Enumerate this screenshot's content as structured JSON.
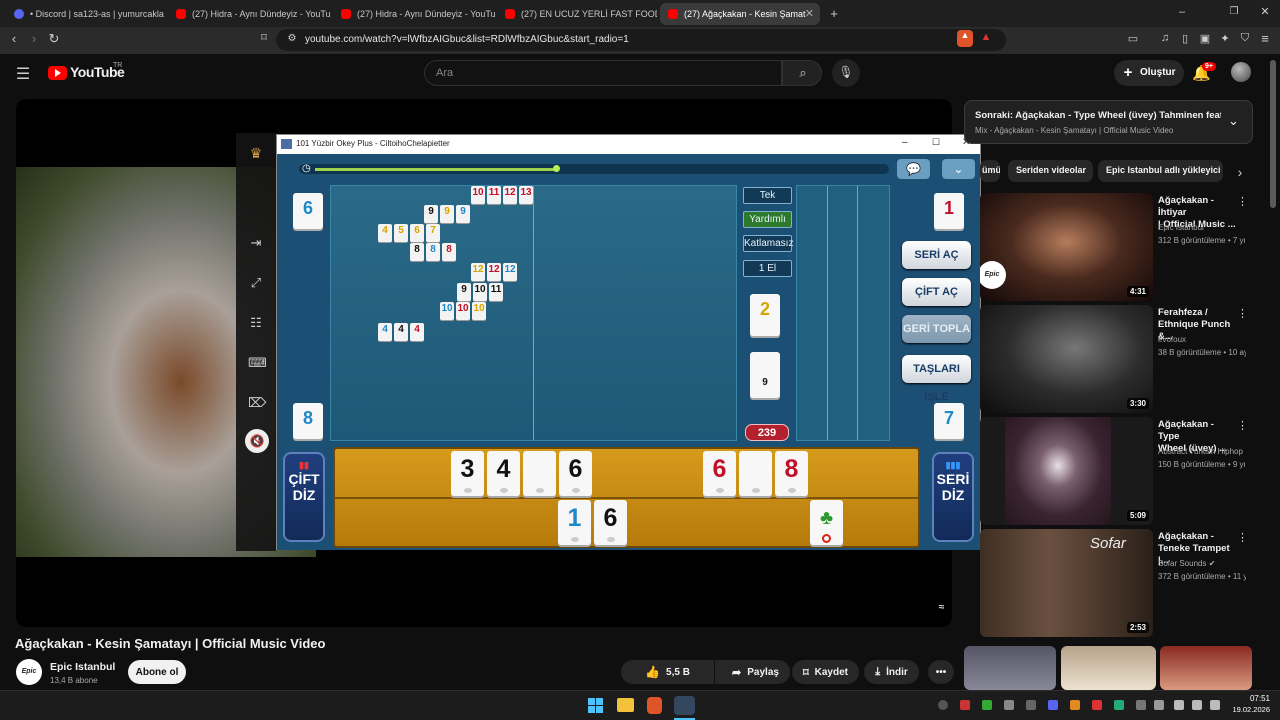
{
  "browser": {
    "tabs": [
      {
        "label": "• Discord | sa123-as | yumurcakla"
      },
      {
        "label": "(27) Hidra - Aynı Dündeyiz - YouTube"
      },
      {
        "label": "(27) Hidra - Aynı Dündeyiz - YouTube"
      },
      {
        "label": "(27) EN UCUZ YERLİ FAST FOOD MEN"
      },
      {
        "label": "(27) Ağaçkakan - Kesin Şamat"
      }
    ],
    "url": "youtube.com/watch?v=lWfbzAIGbuc&list=RDlWfbzAIGbuc&start_radio=1"
  },
  "youtube": {
    "logo": "YouTube",
    "logo_sup": "TR",
    "search_placeholder": "Ara",
    "create_label": "Oluştur",
    "notif_count": "9+"
  },
  "game": {
    "window_title": "101 Yüzbir Okey Plus - CiltoihoChelapietter",
    "left_top_tile": "6",
    "left_bottom_tile": "8",
    "right_top_tile": "1",
    "right_bottom_tile": "7",
    "indicator_tile": "2",
    "deck_tile": "9",
    "score": "239",
    "stats": [
      "Tek",
      "Yardımlı",
      "Katlamasız",
      "1 El"
    ],
    "buttons": {
      "seri_ac": "SERİ AÇ",
      "cift_ac": "ÇİFT AÇ",
      "geri_topla": "GERİ TOPLA",
      "taslari_isle": "TAŞLARI İŞLE"
    },
    "cift_diz": [
      "ÇİFT",
      "DİZ"
    ],
    "seri_diz": [
      "SERİ",
      "DİZ"
    ],
    "table_groups": [
      {
        "tiles": [
          "10",
          "11",
          "12",
          "13"
        ],
        "color": "red"
      },
      {
        "tiles": [
          "9",
          "9",
          "9"
        ],
        "colors": [
          "black",
          "yellow",
          "blue"
        ]
      },
      {
        "tiles": [
          "4",
          "5",
          "6",
          "7"
        ],
        "color": "yellow"
      },
      {
        "tiles": [
          "8",
          "8",
          "8"
        ],
        "colors": [
          "black",
          "blue",
          "red"
        ]
      },
      {
        "tiles": [
          "12",
          "12",
          "12"
        ],
        "colors": [
          "yellow",
          "red",
          "blue"
        ]
      },
      {
        "tiles": [
          "9",
          "10",
          "11"
        ],
        "color": "black"
      },
      {
        "tiles": [
          "10",
          "10",
          "10"
        ],
        "colors": [
          "blue",
          "red",
          "yellow"
        ]
      },
      {
        "tiles": [
          "4",
          "4",
          "4"
        ],
        "colors": [
          "blue",
          "black",
          "red"
        ]
      }
    ],
    "rack_top": [
      "3",
      "4",
      "",
      "6",
      "",
      "",
      "",
      "6",
      "",
      "8"
    ],
    "rack_bottom": [
      "1",
      "6"
    ]
  },
  "video": {
    "title": "Ağaçkakan - Kesin Şamatayı | Official Music Video",
    "channel": "Epic Istanbul",
    "subscribers": "13,4 B abone",
    "subscribe_label": "Abone ol",
    "likes": "5,5 B",
    "share_label": "Paylaş",
    "save_label": "Kaydet",
    "download_label": "İndir"
  },
  "sidebar": {
    "next_title": "Sonraki: Ağaçkakan - Type Wheel (üvey) Tahminen feat. ...",
    "next_sub": "Mix - Ağaçkakan - Kesin Şamatayı | Official Music Video",
    "chips": [
      "ümü",
      "Seriden videolar",
      "Epic Istanbul adlı yükleyici"
    ],
    "recs": [
      {
        "title": "Ağaçkakan - İhtiyar\n| Official Music ...",
        "channel": "Epic Istanbul",
        "meta": "312 B görüntüleme • 7 yıl",
        "duration": "4:31"
      },
      {
        "title": "Ferahfeza /\nEthnique Punch &...",
        "channel": "evofoux",
        "meta": "38 B görüntüleme • 10 ay",
        "duration": "3:30"
      },
      {
        "title": "Ağaçkakan - Type\nWheel (üvey) ...",
        "channel": "Abstract Turkish Hiphop",
        "meta": "150 B görüntüleme • 9 yıl",
        "duration": "5:09"
      },
      {
        "title": "Ağaçkakan -\nTeneke Trampet |...",
        "channel": "Sofar Sounds",
        "meta": "372 B görüntüleme • 11 y",
        "duration": "2:53"
      }
    ]
  },
  "taskbar": {
    "time": "07:51",
    "date": "19.02.2026"
  }
}
